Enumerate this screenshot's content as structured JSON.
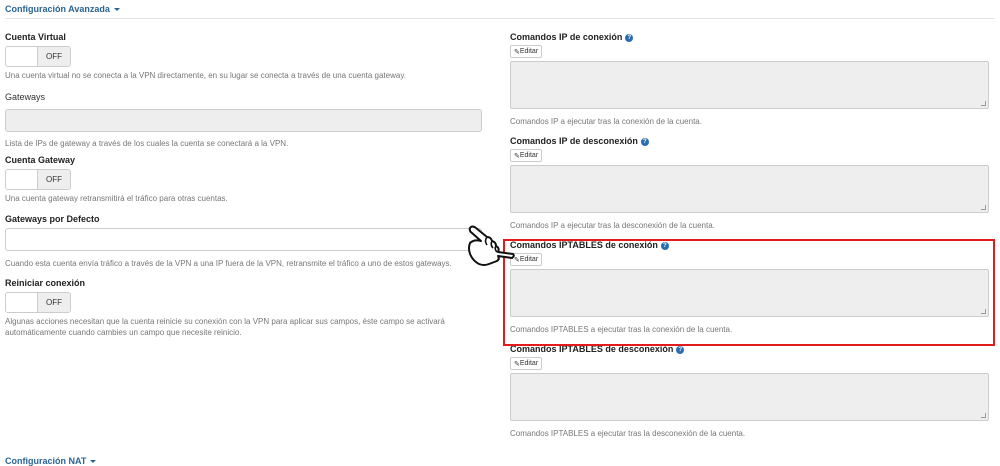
{
  "header": {
    "title": "Configuración Avanzada"
  },
  "left": {
    "virtual_account": {
      "label": "Cuenta Virtual",
      "toggle": "OFF",
      "help": "Una cuenta virtual no se conecta a la VPN directamente, en su lugar se conecta a través de una cuenta gateway."
    },
    "gateways": {
      "label": "Gateways",
      "help": "Lista de IPs de gateway a través de los cuales la cuenta se conectará a la VPN."
    },
    "gateway_account": {
      "label": "Cuenta Gateway",
      "toggle": "OFF",
      "help": "Una cuenta gateway retransmitirá el tráfico para otras cuentas."
    },
    "default_gateways": {
      "label": "Gateways por Defecto",
      "help": "Cuando esta cuenta envía tráfico a través de la VPN a una IP fuera de la VPN, retransmite el tráfico a uno de estos gateways."
    },
    "restart_connection": {
      "label": "Reiniciar conexión",
      "toggle": "OFF",
      "help": "Algunas acciones necesitan que la cuenta reinicie su conexión con la VPN para aplicar sus campos, éste campo se activará automáticamente cuando cambies un campo que necesite reinicio."
    }
  },
  "right": {
    "ip_up": {
      "label": "Comandos IP de conexión",
      "edit": "Editar",
      "help": "Comandos IP a ejecutar tras la conexión de la cuenta."
    },
    "ip_down": {
      "label": "Comandos IP de desconexión",
      "edit": "Editar",
      "help": "Comandos IP a ejecutar tras la desconexión de la cuenta."
    },
    "iptables_up": {
      "label": "Comandos IPTABLES de conexión",
      "edit": "Editar",
      "help": "Comandos IPTABLES a ejecutar tras la conexión de la cuenta."
    },
    "iptables_down": {
      "label": "Comandos IPTABLES de desconexión",
      "edit": "Editar",
      "help": "Comandos IPTABLES a ejecutar tras la desconexión de la cuenta."
    }
  },
  "footer": {
    "title": "Configuración NAT"
  },
  "icons": {
    "info": "question-circle-icon",
    "edit": "edit-icon",
    "pointer": "pointing-hand-icon"
  },
  "colors": {
    "accent": "#2a6496",
    "highlight": "#e21c1c",
    "info": "#2a6db0"
  }
}
